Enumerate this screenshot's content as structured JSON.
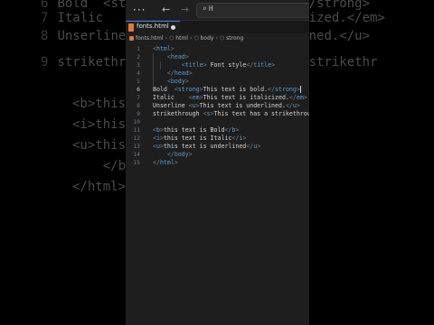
{
  "background": {
    "lines": [
      {
        "num": "6",
        "text": "Bold  <strong>This text is bold.</strong>"
      },
      {
        "num": "7",
        "text": "Italic    <em>This text is italicized.</em>"
      },
      {
        "num": "8",
        "text": "Unserline <u>This text is underlined.</u>"
      },
      {
        "num": "9",
        "text": "strikethrough <s>This text has a strikethr"
      },
      {
        "num": "",
        "text": "<b>this"
      },
      {
        "num": "",
        "text": "<i>this"
      },
      {
        "num": "",
        "text": "<u>this"
      },
      {
        "num": "",
        "text": "    </body"
      },
      {
        "num": "",
        "text": "</html>"
      }
    ]
  },
  "titlebar": {
    "menu": "···",
    "back": "←",
    "forward": "→",
    "search_icon": "⌕",
    "search_text": "H"
  },
  "tab": {
    "label": "fonts.html"
  },
  "breadcrumb": {
    "file": "fonts.html",
    "items": [
      "html",
      "body",
      "strong"
    ]
  },
  "editor": {
    "active_line": 6,
    "lines": [
      {
        "num": "1",
        "tokens": [
          [
            "b",
            "<"
          ],
          [
            "t",
            "html"
          ],
          [
            "b",
            ">"
          ]
        ]
      },
      {
        "num": "2",
        "tokens": [
          [
            "x",
            "    "
          ],
          [
            "b",
            "<"
          ],
          [
            "t",
            "head"
          ],
          [
            "b",
            ">"
          ]
        ]
      },
      {
        "num": "3",
        "tokens": [
          [
            "x",
            "        "
          ],
          [
            "b",
            "<"
          ],
          [
            "t",
            "title"
          ],
          [
            "b",
            ">"
          ],
          [
            "x",
            " Font style"
          ],
          [
            "b",
            "</"
          ],
          [
            "t",
            "title"
          ],
          [
            "b",
            ">"
          ]
        ]
      },
      {
        "num": "4",
        "tokens": [
          [
            "x",
            "    "
          ],
          [
            "b",
            "</"
          ],
          [
            "t",
            "head"
          ],
          [
            "b",
            ">"
          ]
        ]
      },
      {
        "num": "5",
        "tokens": [
          [
            "x",
            "    "
          ],
          [
            "b",
            "<"
          ],
          [
            "t",
            "body"
          ],
          [
            "b",
            ">"
          ]
        ]
      },
      {
        "num": "6",
        "tokens": [
          [
            "x",
            "Bold  "
          ],
          [
            "b",
            "<"
          ],
          [
            "t",
            "strong"
          ],
          [
            "b",
            ">"
          ],
          [
            "x",
            "This text is bold."
          ],
          [
            "b",
            "</"
          ],
          [
            "t",
            "strong"
          ],
          [
            "b",
            ">"
          ]
        ]
      },
      {
        "num": "7",
        "tokens": [
          [
            "x",
            "Italic    "
          ],
          [
            "b",
            "<"
          ],
          [
            "t",
            "em"
          ],
          [
            "b",
            ">"
          ],
          [
            "x",
            "This text is italicized."
          ],
          [
            "b",
            "</"
          ],
          [
            "t",
            "em"
          ],
          [
            "b",
            ">"
          ]
        ]
      },
      {
        "num": "8",
        "tokens": [
          [
            "x",
            "Unserline "
          ],
          [
            "b",
            "<"
          ],
          [
            "t",
            "u"
          ],
          [
            "b",
            ">"
          ],
          [
            "x",
            "This text is underlined."
          ],
          [
            "b",
            "</"
          ],
          [
            "t",
            "u"
          ],
          [
            "b",
            ">"
          ]
        ]
      },
      {
        "num": "9",
        "tokens": [
          [
            "x",
            "strikethrough "
          ],
          [
            "b",
            "<"
          ],
          [
            "t",
            "s"
          ],
          [
            "b",
            ">"
          ],
          [
            "x",
            "This text has a strikethrou"
          ]
        ]
      },
      {
        "num": "10",
        "tokens": []
      },
      {
        "num": "11",
        "tokens": [
          [
            "b",
            "<"
          ],
          [
            "t",
            "b"
          ],
          [
            "b",
            ">"
          ],
          [
            "x",
            "this text is Bold"
          ],
          [
            "b",
            "</"
          ],
          [
            "t",
            "b"
          ],
          [
            "b",
            ">"
          ]
        ]
      },
      {
        "num": "12",
        "tokens": [
          [
            "b",
            "<"
          ],
          [
            "t",
            "i"
          ],
          [
            "b",
            ">"
          ],
          [
            "x",
            "this text is Italic"
          ],
          [
            "b",
            "</"
          ],
          [
            "t",
            "i"
          ],
          [
            "b",
            ">"
          ]
        ]
      },
      {
        "num": "13",
        "tokens": [
          [
            "b",
            "<"
          ],
          [
            "t",
            "u"
          ],
          [
            "b",
            ">"
          ],
          [
            "x",
            "this text is underlined"
          ],
          [
            "b",
            "</"
          ],
          [
            "t",
            "u"
          ],
          [
            "b",
            ">"
          ]
        ]
      },
      {
        "num": "14",
        "tokens": [
          [
            "x",
            "    "
          ],
          [
            "b",
            "</"
          ],
          [
            "t",
            "body"
          ],
          [
            "b",
            ">"
          ]
        ]
      },
      {
        "num": "15",
        "tokens": [
          [
            "b",
            "</"
          ],
          [
            "t",
            "html"
          ],
          [
            "b",
            ">"
          ]
        ]
      }
    ]
  },
  "colors": {
    "tag": "#569cd6",
    "bracket": "#808080",
    "text": "#d4d4d4",
    "editor_bg": "#1e1e1e",
    "accent": "#3b82f6"
  }
}
